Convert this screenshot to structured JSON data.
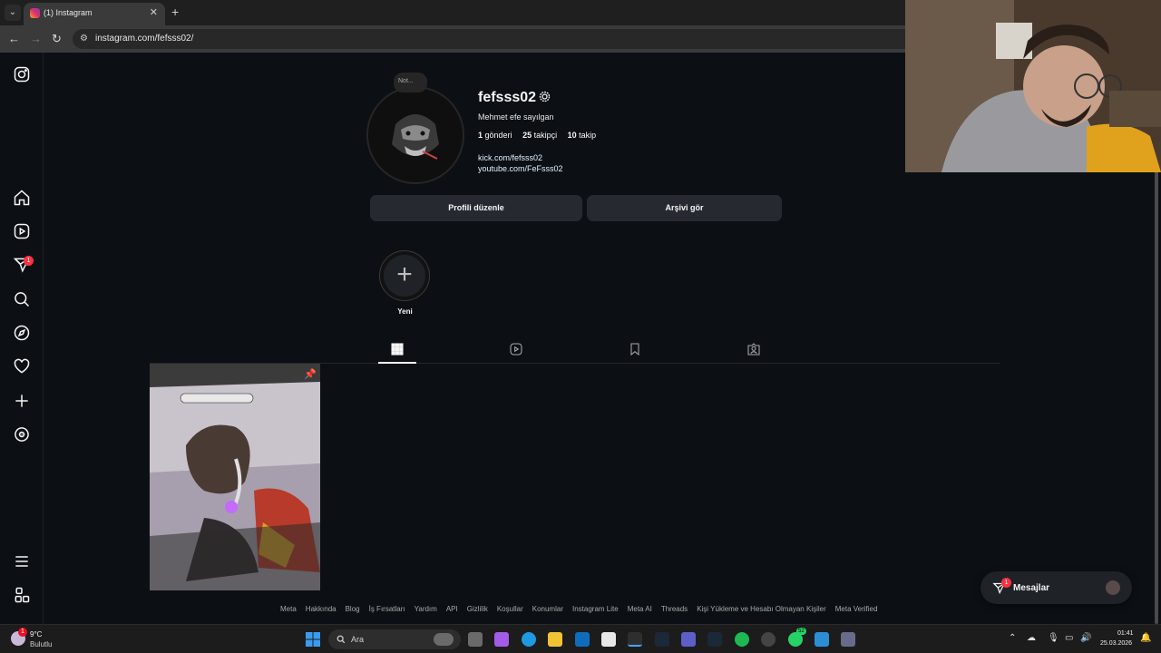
{
  "browser": {
    "tab_title": "(1) Instagram",
    "close": "✕",
    "new_tab": "+",
    "url": "instagram.com/fefsss02/"
  },
  "sidebar": {
    "notification_badge": "1"
  },
  "profile": {
    "note_placeholder": "Not...",
    "username": "fefsss02",
    "full_name": "Mehmet efe sayılgan",
    "posts_count": "1",
    "posts_label": "gönderi",
    "followers_count": "25",
    "followers_label": "takipçi",
    "following_count": "10",
    "following_label": "takip",
    "links": [
      "kick.com/fefsss02",
      "youtube.com/FeFsss02"
    ],
    "edit_button": "Profili düzenle",
    "archive_button": "Arşivi gör",
    "new_story_label": "Yeni"
  },
  "footer": {
    "links": [
      "Meta",
      "Hakkında",
      "Blog",
      "İş Fırsatları",
      "Yardım",
      "API",
      "Gizlilik",
      "Koşullar",
      "Konumlar",
      "Instagram Lite",
      "Meta AI",
      "Threads",
      "Kişi Yükleme ve Hesabı Olmayan Kişiler",
      "Meta Verified"
    ]
  },
  "messages": {
    "label": "Mesajlar",
    "badge": "1"
  },
  "taskbar": {
    "weather_temp": "9°C",
    "weather_desc": "Bulutlu",
    "search_text": "Ara",
    "time": "01:41",
    "date": "25.03.2026",
    "weather_badge": "1",
    "whatsapp_badge": "52"
  },
  "colors": {
    "background": "#0c1014",
    "button": "#262a30",
    "badge": "#ff3040"
  }
}
